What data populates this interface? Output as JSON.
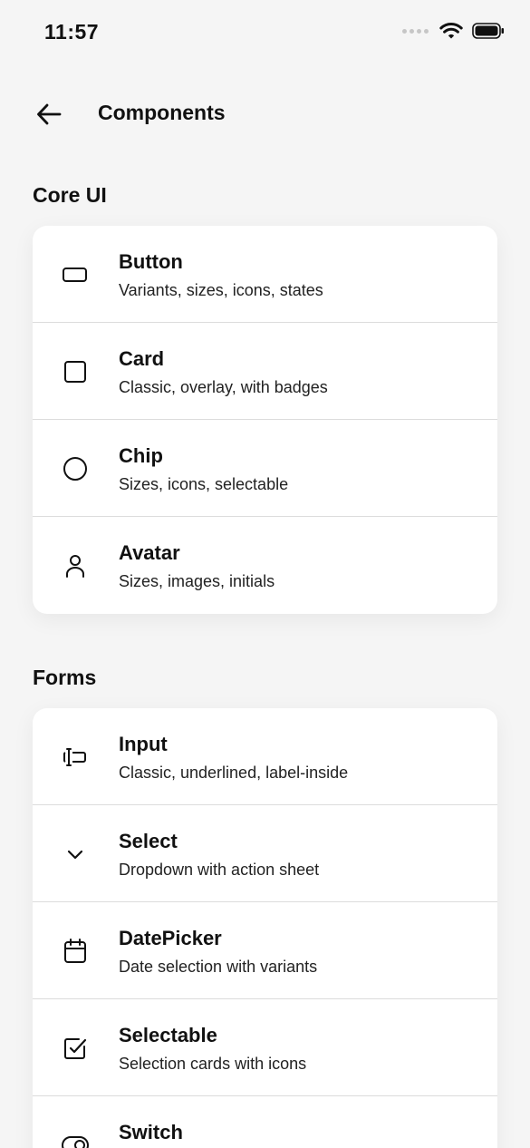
{
  "status_bar": {
    "time": "11:57"
  },
  "header": {
    "title": "Components"
  },
  "sections": [
    {
      "title": "Core UI",
      "items": [
        {
          "title": "Button",
          "subtitle": "Variants, sizes, icons, states",
          "icon": "button-rect-icon"
        },
        {
          "title": "Card",
          "subtitle": "Classic, overlay, with badges",
          "icon": "square-icon"
        },
        {
          "title": "Chip",
          "subtitle": "Sizes, icons, selectable",
          "icon": "circle-icon"
        },
        {
          "title": "Avatar",
          "subtitle": "Sizes, images, initials",
          "icon": "person-icon"
        }
      ]
    },
    {
      "title": "Forms",
      "items": [
        {
          "title": "Input",
          "subtitle": "Classic, underlined, label-inside",
          "icon": "text-cursor-icon"
        },
        {
          "title": "Select",
          "subtitle": "Dropdown with action sheet",
          "icon": "chevron-down-icon"
        },
        {
          "title": "DatePicker",
          "subtitle": "Date selection with variants",
          "icon": "calendar-icon"
        },
        {
          "title": "Selectable",
          "subtitle": "Selection cards with icons",
          "icon": "checkbox-icon"
        },
        {
          "title": "Switch",
          "subtitle": "",
          "icon": "toggle-icon"
        }
      ]
    }
  ]
}
